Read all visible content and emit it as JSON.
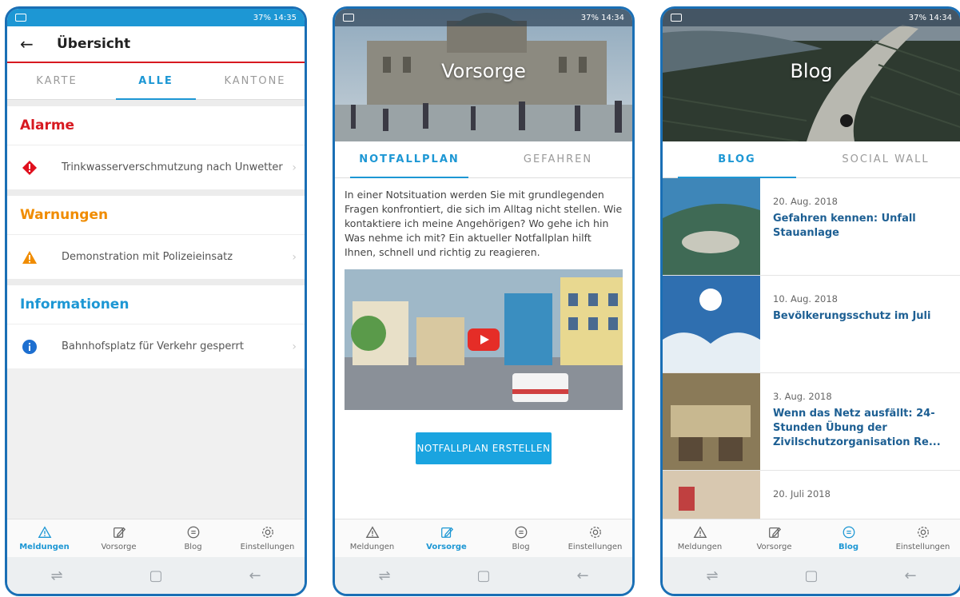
{
  "status": {
    "screen1": "37% 14:35",
    "screen2": "37% 14:34",
    "screen3": "37% 14:34"
  },
  "nav": {
    "items": [
      "Meldungen",
      "Vorsorge",
      "Blog",
      "Einstellungen"
    ]
  },
  "overview": {
    "title": "Übersicht",
    "tabs": [
      "KARTE",
      "ALLE",
      "KANTONE"
    ],
    "active_tab": "ALLE",
    "sections": {
      "alarms": {
        "title": "Alarme",
        "items": [
          "Trinkwasserverschmutzung nach Unwetter"
        ]
      },
      "warnings": {
        "title": "Warnungen",
        "items": [
          "Demonstration mit Polizeieinsatz"
        ]
      },
      "infos": {
        "title": "Informationen",
        "items": [
          "Bahnhofsplatz für Verkehr gesperrt"
        ]
      }
    },
    "colors": {
      "alarm": "#d71920",
      "warning": "#f08c00",
      "info": "#1d97d4"
    }
  },
  "vorsorge": {
    "hero_title": "Vorsorge",
    "tabs": [
      "NOTFALLPLAN",
      "GEFAHREN"
    ],
    "active_tab": "NOTFALLPLAN",
    "text": "In einer Notsituation werden Sie mit grundlegenden Fragen konfrontiert, die sich im Alltag nicht stellen. Wie kontaktiere ich meine Angehörigen? Wo gehe ich hin Was nehme ich mit? Ein aktueller Notfallplan hilft Ihnen, schnell und richtig zu reagieren.",
    "cta_label": "NOTFALLPLAN ERSTELLEN"
  },
  "blog": {
    "hero_title": "Blog",
    "tabs": [
      "BLOG",
      "SOCIAL WALL"
    ],
    "active_tab": "BLOG",
    "posts": [
      {
        "date": "20. Aug. 2018",
        "title": "Gefahren kennen: Unfall Stauanlage"
      },
      {
        "date": "10. Aug. 2018",
        "title": "Bevölkerungsschutz im Juli"
      },
      {
        "date": "3. Aug. 2018",
        "title": "Wenn das Netz ausfällt: 24-Stunden Übung der Zivilschutzorganisation Re..."
      },
      {
        "date": "20. Juli 2018",
        "title": ""
      }
    ]
  },
  "accent_color": "#1d97d4"
}
